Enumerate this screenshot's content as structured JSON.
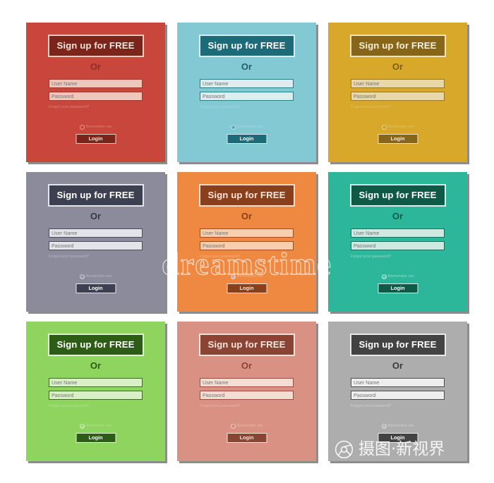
{
  "common": {
    "signup_label": "Sign up for FREE",
    "or_label": "Or",
    "username_placeholder": "User Name",
    "password_placeholder": "Password",
    "forgot_label": "Forgot your password?",
    "remember_label": "Remember me",
    "login_label": "Login"
  },
  "watermarks": {
    "center": "dreamstime",
    "bottom_right": "摄图·新视界",
    "logo_icon": "camera-aperture-icon"
  },
  "cards": [
    {
      "name": "red",
      "bg": "#c8463c",
      "accent": "#7b2419",
      "accent_text": "#f2e4de",
      "field_bg": "#f0c6bb",
      "field_text": "#8a3326",
      "field_border": "#a5372a",
      "or_color": "#8c2f23",
      "muted_text": "#d98377",
      "signup_border": "#e8cdc6",
      "login_bg": "#7b2419",
      "login_text": "#f2e4de",
      "login_border": "#e8cdc6",
      "radio_border": "#e09b8f",
      "radio_checked": false,
      "radio_fill": "transparent",
      "radio_tick": ""
    },
    {
      "name": "sky-blue",
      "bg": "#82c9d3",
      "accent": "#1d6a78",
      "accent_text": "#ffffff",
      "field_bg": "#dcecef",
      "field_text": "#3e7f8b",
      "field_border": "#2c7d8c",
      "or_color": "#235f6b",
      "muted_text": "#a5d5dd",
      "signup_border": "#d6eef2",
      "login_bg": "#1d6a78",
      "login_text": "#ffffff",
      "login_border": "#d6eef2",
      "radio_border": "#bfe0e6",
      "radio_checked": true,
      "radio_fill": "#5aa8b5",
      "radio_tick": "✔"
    },
    {
      "name": "gold",
      "bg": "#d8a82a",
      "accent": "#87661a",
      "accent_text": "#f6eeda",
      "field_bg": "#e8d7a8",
      "field_text": "#8a6a1d",
      "field_border": "#9c7820",
      "or_color": "#7d5f18",
      "muted_text": "#e0bf66",
      "signup_border": "#f0e3c0",
      "login_bg": "#87661a",
      "login_text": "#f6eeda",
      "login_border": "#f0e3c0",
      "radio_border": "#ecd9a0",
      "radio_checked": true,
      "radio_fill": "#c79c33",
      "radio_tick": "✔"
    },
    {
      "name": "slate",
      "bg": "#8b8b9c",
      "accent": "#3d4050",
      "accent_text": "#ffffff",
      "field_bg": "#e3e3ea",
      "field_text": "#5a5c6d",
      "field_border": "#4a4d5e",
      "or_color": "#35384a",
      "muted_text": "#b5b5c2",
      "signup_border": "#e4e4ea",
      "login_bg": "#3d4050",
      "login_text": "#ffffff",
      "login_border": "#e4e4ea",
      "radio_border": "#cfcfd9",
      "radio_checked": true,
      "radio_fill": "#9b9bab",
      "radio_tick": "✔"
    },
    {
      "name": "orange",
      "bg": "#ef8942",
      "accent": "#8a3f1c",
      "accent_text": "#f8e5d8",
      "field_bg": "#f7cfae",
      "field_text": "#9c5227",
      "field_border": "#a8491f",
      "or_color": "#8a3f1c",
      "muted_text": "#f5b07a",
      "signup_border": "#f7ded0",
      "login_bg": "#8a3f1c",
      "login_text": "#f8e5d8",
      "login_border": "#f7ded0",
      "radio_border": "#f7d0b3",
      "radio_checked": true,
      "radio_fill": "#d9accb",
      "radio_tick": "✔"
    },
    {
      "name": "teal",
      "bg": "#2cb79a",
      "accent": "#0f5a47",
      "accent_text": "#ffffff",
      "field_bg": "#cfe9e2",
      "field_text": "#2b7f6b",
      "field_border": "#14705a",
      "or_color": "#0f5a47",
      "muted_text": "#93d9c8",
      "signup_border": "#d7efe8",
      "login_bg": "#0f5a47",
      "login_text": "#ffffff",
      "login_border": "#d7efe8",
      "radio_border": "#c6e9df",
      "radio_checked": true,
      "radio_fill": "#63c8b0",
      "radio_tick": "✔"
    },
    {
      "name": "green",
      "bg": "#8ed45e",
      "accent": "#2c5c15",
      "accent_text": "#ffffff",
      "field_bg": "#d9f0c6",
      "field_text": "#4c8029",
      "field_border": "#36701b",
      "or_color": "#2c5c15",
      "muted_text": "#b2e18e",
      "signup_border": "#dff3d0",
      "login_bg": "#2c5c15",
      "login_text": "#ffffff",
      "login_border": "#dff3d0",
      "radio_border": "#d4efc0",
      "radio_checked": true,
      "radio_fill": "#a8dd80",
      "radio_tick": "✔"
    },
    {
      "name": "salmon",
      "bg": "#d99183",
      "accent": "#8a4434",
      "accent_text": "#f7e4dc",
      "field_bg": "#f4ded4",
      "field_text": "#96503f",
      "field_border": "#9c4d3b",
      "or_color": "#8a4434",
      "muted_text": "#e8b5a8",
      "signup_border": "#f6e3db",
      "login_bg": "#8a4434",
      "login_text": "#f7e4dc",
      "login_border": "#f6e3db",
      "radio_border": "#f0cfc3",
      "radio_checked": true,
      "radio_fill": "#c98d7d",
      "radio_tick": "✔"
    },
    {
      "name": "gray",
      "bg": "#adadad",
      "accent": "#434343",
      "accent_text": "#ffffff",
      "field_bg": "#eeeeee",
      "field_text": "#666666",
      "field_border": "#4d4d4d",
      "or_color": "#3a3a3a",
      "muted_text": "#cfcfcf",
      "signup_border": "#e9e9e9",
      "login_bg": "#434343",
      "login_text": "#ffffff",
      "login_border": "#e9e9e9",
      "radio_border": "#dcdcdc",
      "radio_checked": true,
      "radio_fill": "#bdbdbd",
      "radio_tick": "✔"
    }
  ]
}
